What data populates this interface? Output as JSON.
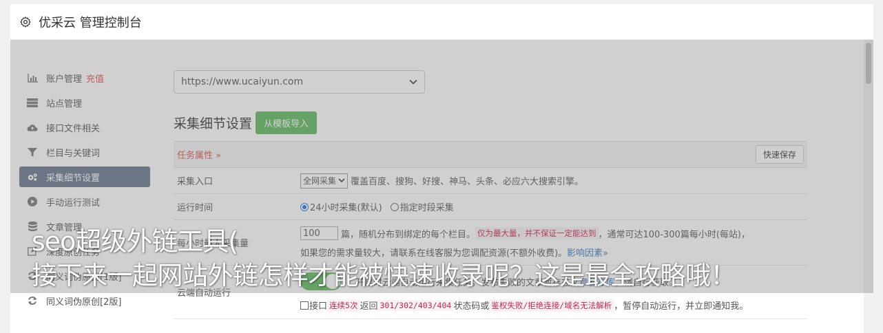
{
  "header": {
    "title": "优采云 管理控制台",
    "icon": "gear-icon"
  },
  "sidebar": {
    "items": [
      {
        "label": "账户管理",
        "badge": "充值",
        "icon": "bar-chart-icon",
        "active": false
      },
      {
        "label": "站点管理",
        "icon": "server-icon",
        "active": false
      },
      {
        "label": "接口文件相关",
        "icon": "cloud-upload-icon",
        "active": false
      },
      {
        "label": "栏目与关键词",
        "icon": "filter-icon",
        "active": false
      },
      {
        "label": "采集细节设置",
        "icon": "gears-icon",
        "active": true
      },
      {
        "label": "手动运行测试",
        "icon": "play-icon",
        "active": false
      },
      {
        "label": "文章管理",
        "icon": "database-icon",
        "active": false
      },
      {
        "label": "深度原创任务",
        "icon": "edit-icon",
        "active": false
      },
      {
        "label": "同义词伪原创[1版]",
        "icon": "refresh-icon",
        "active": false
      },
      {
        "label": "同义词伪原创[2版]",
        "icon": "refresh-icon",
        "active": false
      }
    ]
  },
  "main": {
    "site_select": "https://www.ucaiyun.com",
    "section_title": "采集细节设置",
    "import_button": "从模板导入",
    "card": {
      "head_label": "任务属性 »",
      "save_button": "快速保存",
      "rows": {
        "entry": {
          "label": "采集入口",
          "select": "全网采集",
          "text": "覆盖百度、搜狗、好搜、神马、头条、必应六大搜索引擎。"
        },
        "time": {
          "label": "运行时间",
          "opt1": "24小时采集(默认)",
          "opt2": "指定时段采集"
        },
        "count": {
          "label": "每小时最大采集量",
          "value": "100",
          "t1": "篇，随机分布到绑定的每个栏目。",
          "red": "仅为最大量，并不保证一定能达到",
          "t2": "，通常可达100-300篇每小时(每站)，",
          "t3": "如果您的需求量较大，请联系在线客服为您调配资源(不额外收费)。",
          "link": "影响因素»"
        },
        "cloud": {
          "label": "云端自动运行",
          "t1": "开启时云端自动运行采集任务。发布失败的文章暂存在",
          "link": "文章暂存库",
          "t2": "，请自行获取。",
          "c1": "接口",
          "code1": "连续5次",
          "c2": "返回",
          "code2": "301/302/403/404",
          "c3": "状态码或",
          "code3": "鉴权失败/拒绝连接/域名无法解析",
          "c4": "，暂停自动运行，并立即通知我。"
        }
      }
    }
  },
  "banner": {
    "line1": "seo超级外链工具(",
    "line2": "接下来一起网站外链怎样才能被快速收录呢？这是最全攻略哦！"
  }
}
